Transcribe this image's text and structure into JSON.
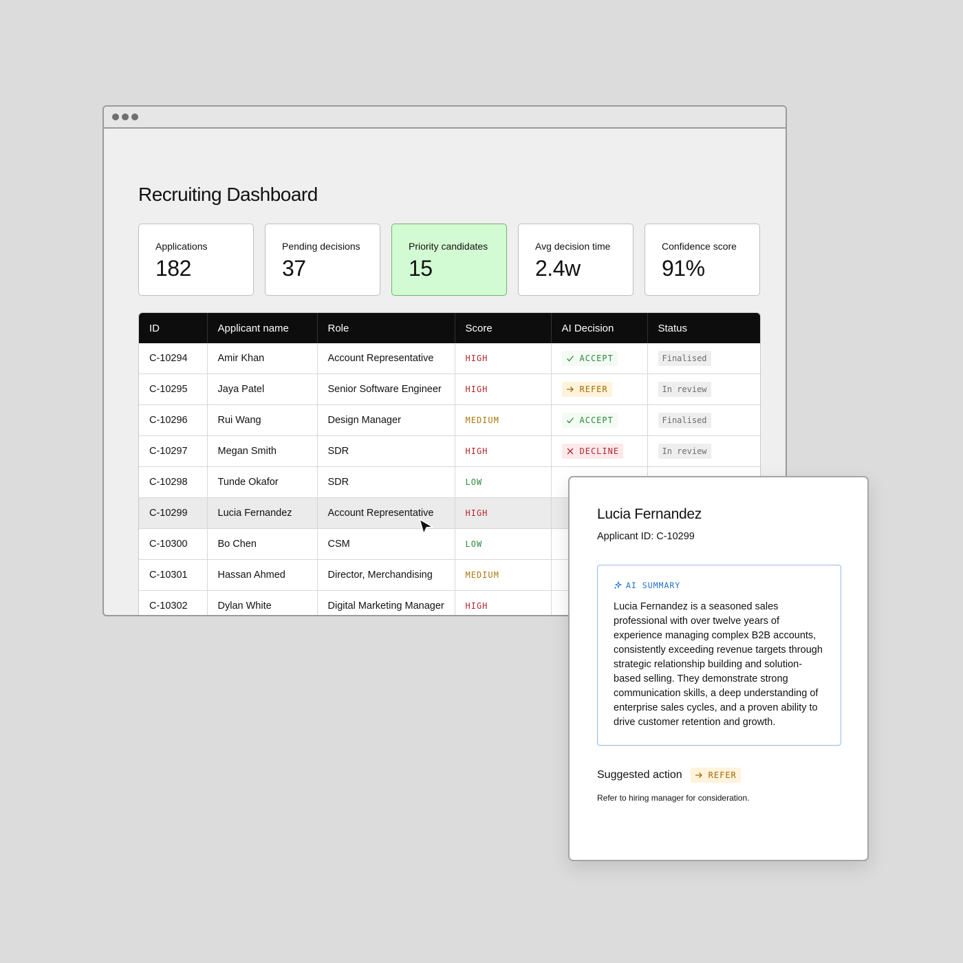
{
  "page_title": "Recruiting Dashboard",
  "kpis": [
    {
      "label": "Applications",
      "value": "182"
    },
    {
      "label": "Pending decisions",
      "value": "37"
    },
    {
      "label": "Priority candidates",
      "value": "15"
    },
    {
      "label": "Avg decision time",
      "value": "2.4w"
    },
    {
      "label": "Confidence score",
      "value": "91%"
    }
  ],
  "table": {
    "headers": [
      "ID",
      "Applicant name",
      "Role",
      "Score",
      "AI Decision",
      "Status"
    ],
    "rows": [
      {
        "id": "C-10294",
        "name": "Amir Khan",
        "role": "Account Representative",
        "score": "HIGH",
        "decision": "ACCEPT",
        "status": "Finalised"
      },
      {
        "id": "C-10295",
        "name": "Jaya Patel",
        "role": "Senior Software Engineer",
        "score": "HIGH",
        "decision": "REFER",
        "status": "In review"
      },
      {
        "id": "C-10296",
        "name": "Rui Wang",
        "role": "Design Manager",
        "score": "MEDIUM",
        "decision": "ACCEPT",
        "status": "Finalised"
      },
      {
        "id": "C-10297",
        "name": "Megan Smith",
        "role": "SDR",
        "score": "HIGH",
        "decision": "DECLINE",
        "status": "In review"
      },
      {
        "id": "C-10298",
        "name": "Tunde Okafor",
        "role": "SDR",
        "score": "LOW",
        "decision": "",
        "status": ""
      },
      {
        "id": "C-10299",
        "name": "Lucia Fernandez",
        "role": "Account Representative",
        "score": "HIGH",
        "decision": "",
        "status": ""
      },
      {
        "id": "C-10300",
        "name": "Bo Chen",
        "role": "CSM",
        "score": "LOW",
        "decision": "",
        "status": ""
      },
      {
        "id": "C-10301",
        "name": "Hassan Ahmed",
        "role": "Director, Merchandising",
        "score": "MEDIUM",
        "decision": "",
        "status": ""
      },
      {
        "id": "C-10302",
        "name": "Dylan White",
        "role": "Digital Marketing Manager",
        "score": "HIGH",
        "decision": "",
        "status": ""
      }
    ]
  },
  "detail": {
    "name": "Lucia Fernandez",
    "applicant_id": "Applicant ID: C-10299",
    "summary_title": "AI SUMMARY",
    "summary_text": "Lucia Fernandez is a seasoned sales professional with over twelve years of experience managing complex B2B accounts, consistently exceeding revenue targets through strategic relationship building and solution-based selling. They demonstrate strong communication skills, a deep understanding of enterprise sales cycles, and a proven ability to drive customer retention and growth.",
    "suggested_label": "Suggested action",
    "suggested_action": "REFER",
    "suggested_note": "Refer to hiring manager for consideration."
  },
  "colors": {
    "priority_card_bg": "#d3fbd3",
    "high": "#b3262d",
    "medium": "#a9770a",
    "low": "#2d8a3c",
    "accept": "#2d8a3c",
    "refer": "#a46a00",
    "decline": "#b3262d",
    "ai_accent": "#1e6fd0"
  },
  "icons": {
    "accept": "check-icon",
    "refer": "arrow-right-icon",
    "decline": "x-icon",
    "ai": "sparkle-icon",
    "pointer": "cursor-arrow-icon"
  }
}
